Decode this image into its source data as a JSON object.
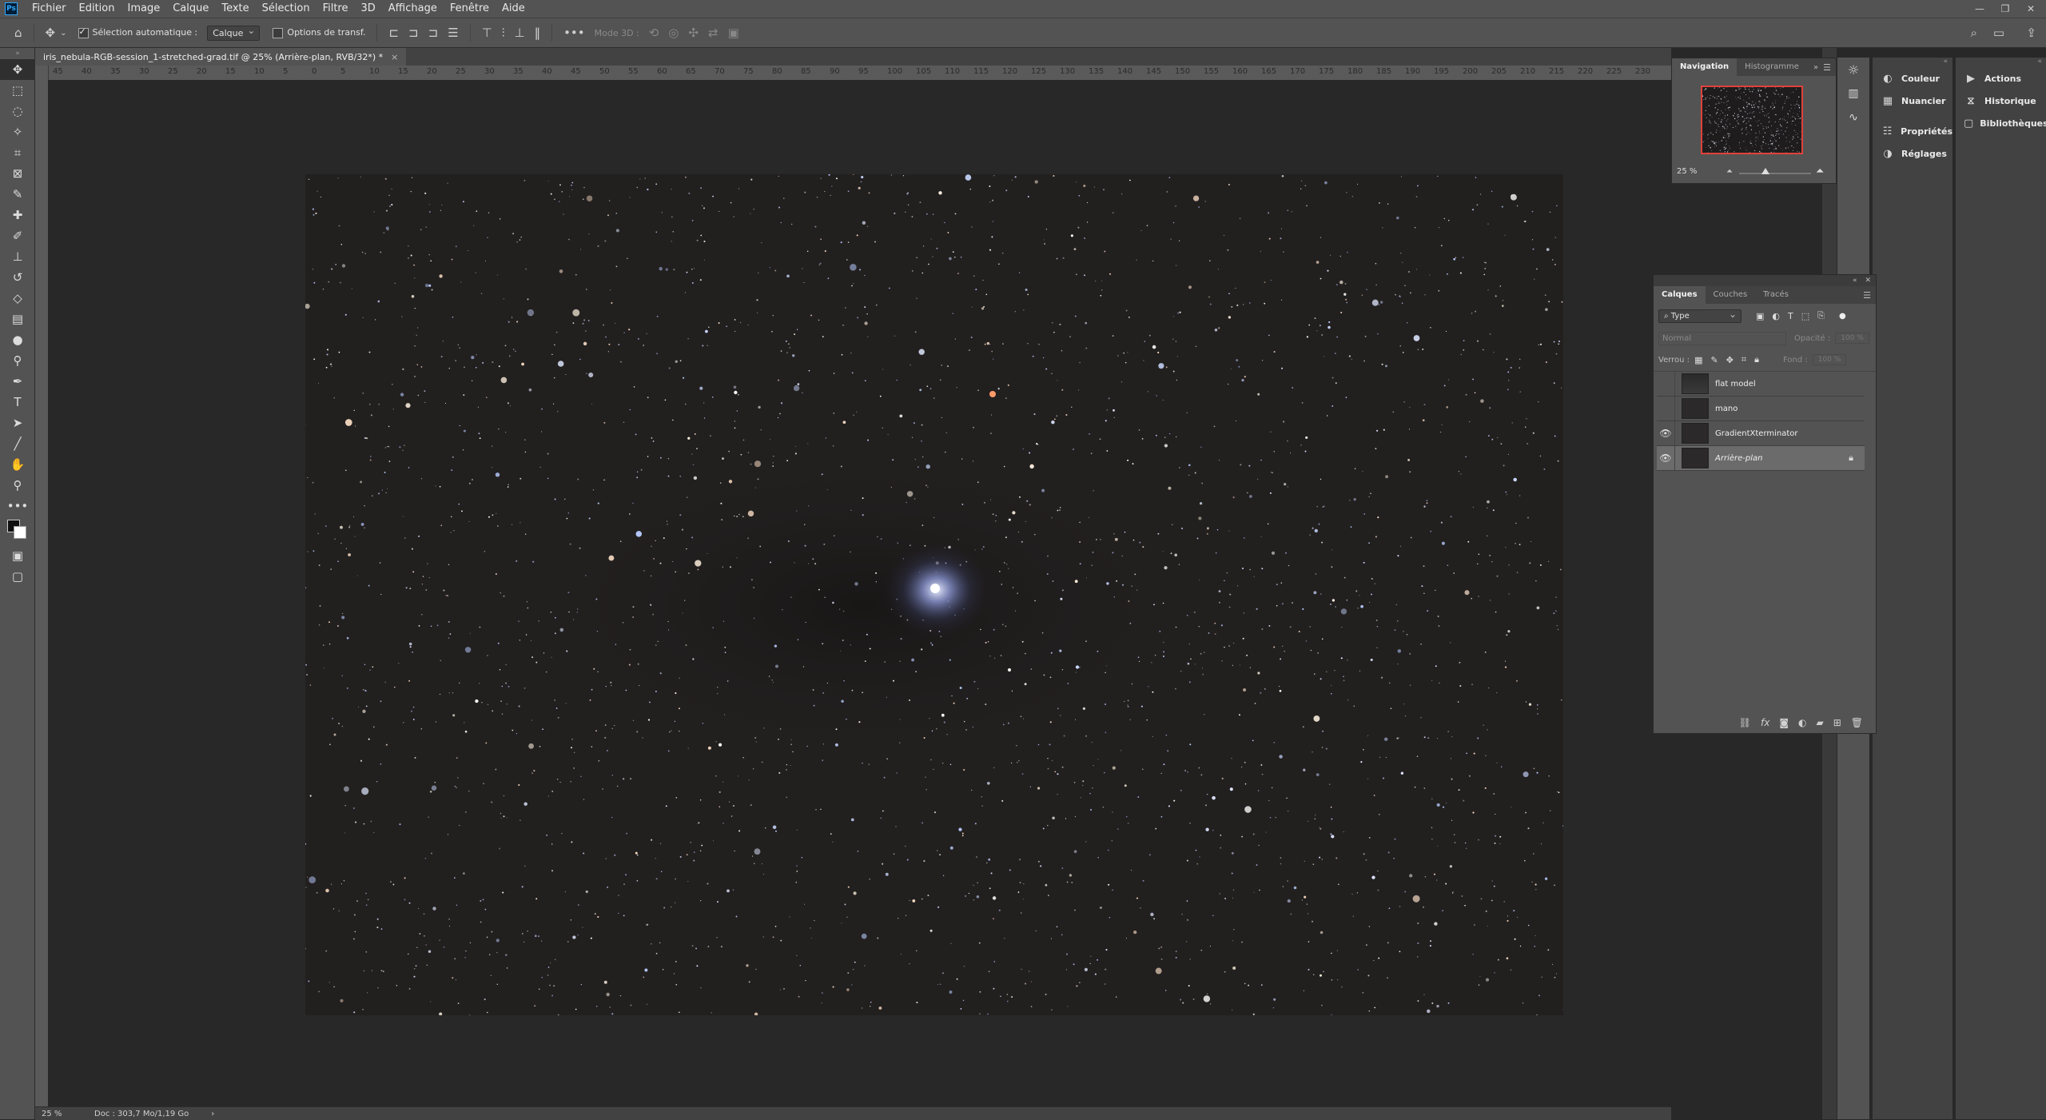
{
  "menubar": {
    "logo": "Ps",
    "items": [
      "Fichier",
      "Edition",
      "Image",
      "Calque",
      "Texte",
      "Sélection",
      "Filtre",
      "3D",
      "Affichage",
      "Fenêtre",
      "Aide"
    ]
  },
  "options": {
    "auto_select_label": "Sélection automatique :",
    "auto_select_value": "Calque",
    "transform_label": "Options de transf.",
    "mode3d_label": "Mode 3D :"
  },
  "document": {
    "tab_title": "iris_nebula-RGB-session_1-stretched-grad.tif @ 25% (Arrière-plan, RVB/32*) *",
    "ruler_labels": [
      "45",
      "40",
      "35",
      "30",
      "25",
      "20",
      "15",
      "10",
      "5",
      "0",
      "5",
      "10",
      "15",
      "20",
      "25",
      "30",
      "35",
      "40",
      "45",
      "50",
      "55",
      "60",
      "65",
      "70",
      "75",
      "80",
      "85",
      "90",
      "95",
      "100",
      "105",
      "110",
      "115",
      "120",
      "125",
      "130",
      "135",
      "140",
      "145",
      "150",
      "155",
      "160",
      "165",
      "170",
      "175",
      "180",
      "185",
      "190",
      "195",
      "200",
      "205",
      "210",
      "215",
      "220",
      "225",
      "230"
    ]
  },
  "status": {
    "zoom": "25 %",
    "doc": "Doc : 303,7 Mo/1,19 Go",
    "arrow": "›"
  },
  "navigator": {
    "tabs": [
      "Navigation",
      "Histogramme"
    ],
    "zoom": "25 %"
  },
  "panel_col1": {
    "items": [
      {
        "icon": "color-palette-icon",
        "label": "Couleur"
      },
      {
        "icon": "swatches-icon",
        "label": "Nuancier"
      },
      {
        "icon": "properties-icon",
        "label": "Propriétés"
      },
      {
        "icon": "adjustments-icon",
        "label": "Réglages"
      }
    ]
  },
  "panel_col2": {
    "items": [
      {
        "icon": "play-icon",
        "label": "Actions"
      },
      {
        "icon": "history-icon",
        "label": "Historique"
      },
      {
        "icon": "libraries-icon",
        "label": "Bibliothèques"
      }
    ]
  },
  "layers": {
    "tabs": [
      "Calques",
      "Couches",
      "Tracés"
    ],
    "filter": "Type",
    "blend_mode": "Normal",
    "opacity_label": "Opacité :",
    "opacity_value": "100 %",
    "lock_label": "Verrou :",
    "fill_label": "Fond :",
    "fill_value": "100 %",
    "items": [
      {
        "name": "flat model",
        "visible": false,
        "selected": false
      },
      {
        "name": "mano",
        "visible": false,
        "selected": false
      },
      {
        "name": "GradientXterminator",
        "visible": true,
        "selected": false
      },
      {
        "name": "Arrière-plan",
        "visible": true,
        "selected": true,
        "locked": true
      }
    ]
  }
}
